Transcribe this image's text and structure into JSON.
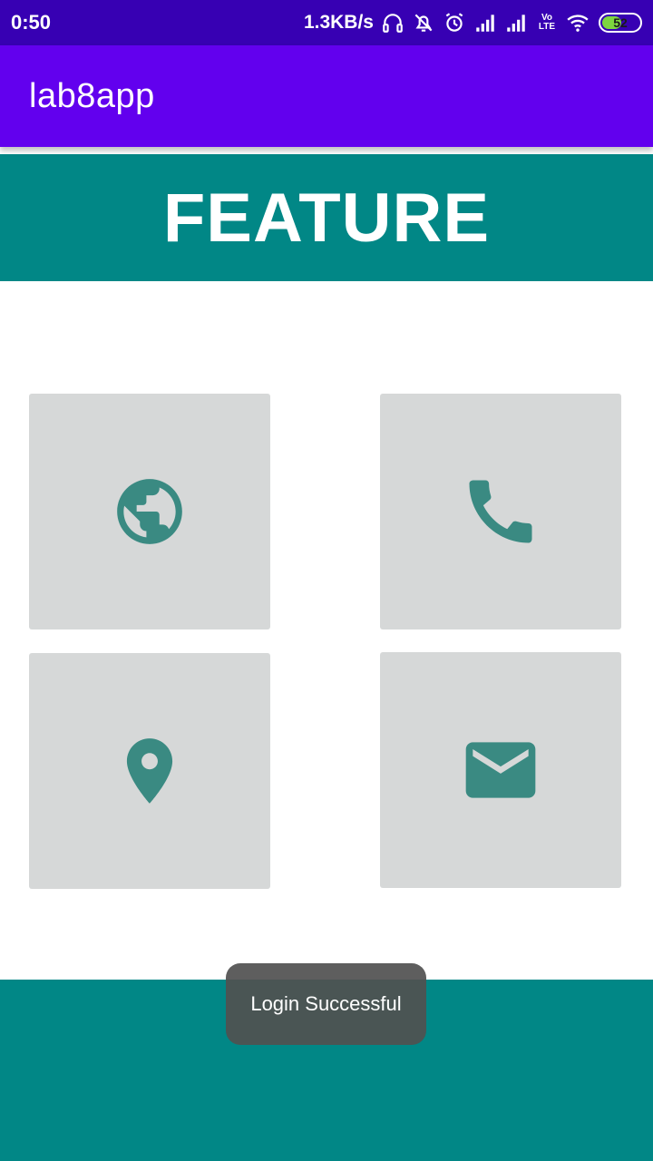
{
  "status_bar": {
    "time": "0:50",
    "network_speed": "1.3KB/s",
    "volte_label": "Vo¹⁾ LTE",
    "battery_level": "52",
    "battery_fraction": 0.52,
    "battery_color": "#7dd63f",
    "icons": [
      "headphones-icon",
      "notifications-off-icon",
      "alarm-icon",
      "signal-icon",
      "signal-icon",
      "volte-icon",
      "wifi-icon",
      "battery-icon"
    ]
  },
  "app_bar": {
    "title": "lab8app",
    "color": "#6200ee"
  },
  "banner": {
    "title": "FEATURE",
    "color": "#018786"
  },
  "tiles": [
    {
      "icon": "globe-icon"
    },
    {
      "icon": "phone-icon"
    },
    {
      "icon": "location-pin-icon"
    },
    {
      "icon": "mail-icon"
    }
  ],
  "icon_color": "#3a8a82",
  "toast": {
    "message": "Login Successful"
  }
}
